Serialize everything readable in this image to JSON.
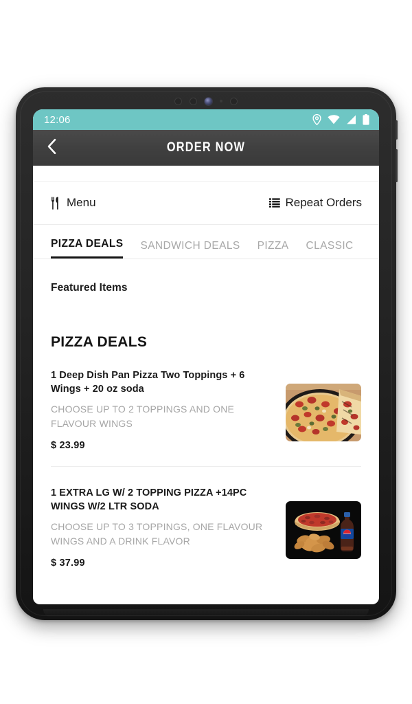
{
  "statusbar": {
    "time": "12:06",
    "icons": [
      "location-pin-icon",
      "wifi-icon",
      "cellular-signal-icon",
      "battery-icon"
    ]
  },
  "appbar": {
    "back_icon": "chevron-left-icon",
    "title": "ORDER NOW"
  },
  "menurow": {
    "menu_label": "Menu",
    "menu_icon": "fork-knife-icon",
    "repeat_label": "Repeat Orders",
    "repeat_icon": "list-icon"
  },
  "tabs": [
    {
      "label": "PIZZA DEALS",
      "active": true
    },
    {
      "label": "SANDWICH DEALS",
      "active": false
    },
    {
      "label": "PIZZA",
      "active": false
    },
    {
      "label": "CLASSIC",
      "active": false
    }
  ],
  "content": {
    "featured_label": "Featured Items",
    "section_title": "PIZZA DEALS"
  },
  "items": [
    {
      "title": "1 Deep Dish Pan Pizza Two Toppings + 6 Wings + 20 oz soda",
      "description": "CHOOSE UP TO 2 TOPPINGS AND ONE FLAVOUR WINGS",
      "price": "$ 23.99",
      "thumb": "pepperoni-pan-pizza-photo"
    },
    {
      "title": "1 EXTRA LG W/ 2 TOPPING PIZZA +14PC WINGS W/2 LTR SODA",
      "description": "CHOOSE UP TO 3 TOPPINGS, ONE FLAVOUR WINGS AND A DRINK FLAVOR",
      "price": "$ 37.99",
      "thumb": "pizza-wings-soda-photo"
    }
  ],
  "colors": {
    "statusbar_teal": "#6ec6c4",
    "appbar_gray": "#3f3f3f",
    "accent_black": "#151515",
    "muted_gray": "#a6a6a6",
    "device_black": "#232323"
  }
}
